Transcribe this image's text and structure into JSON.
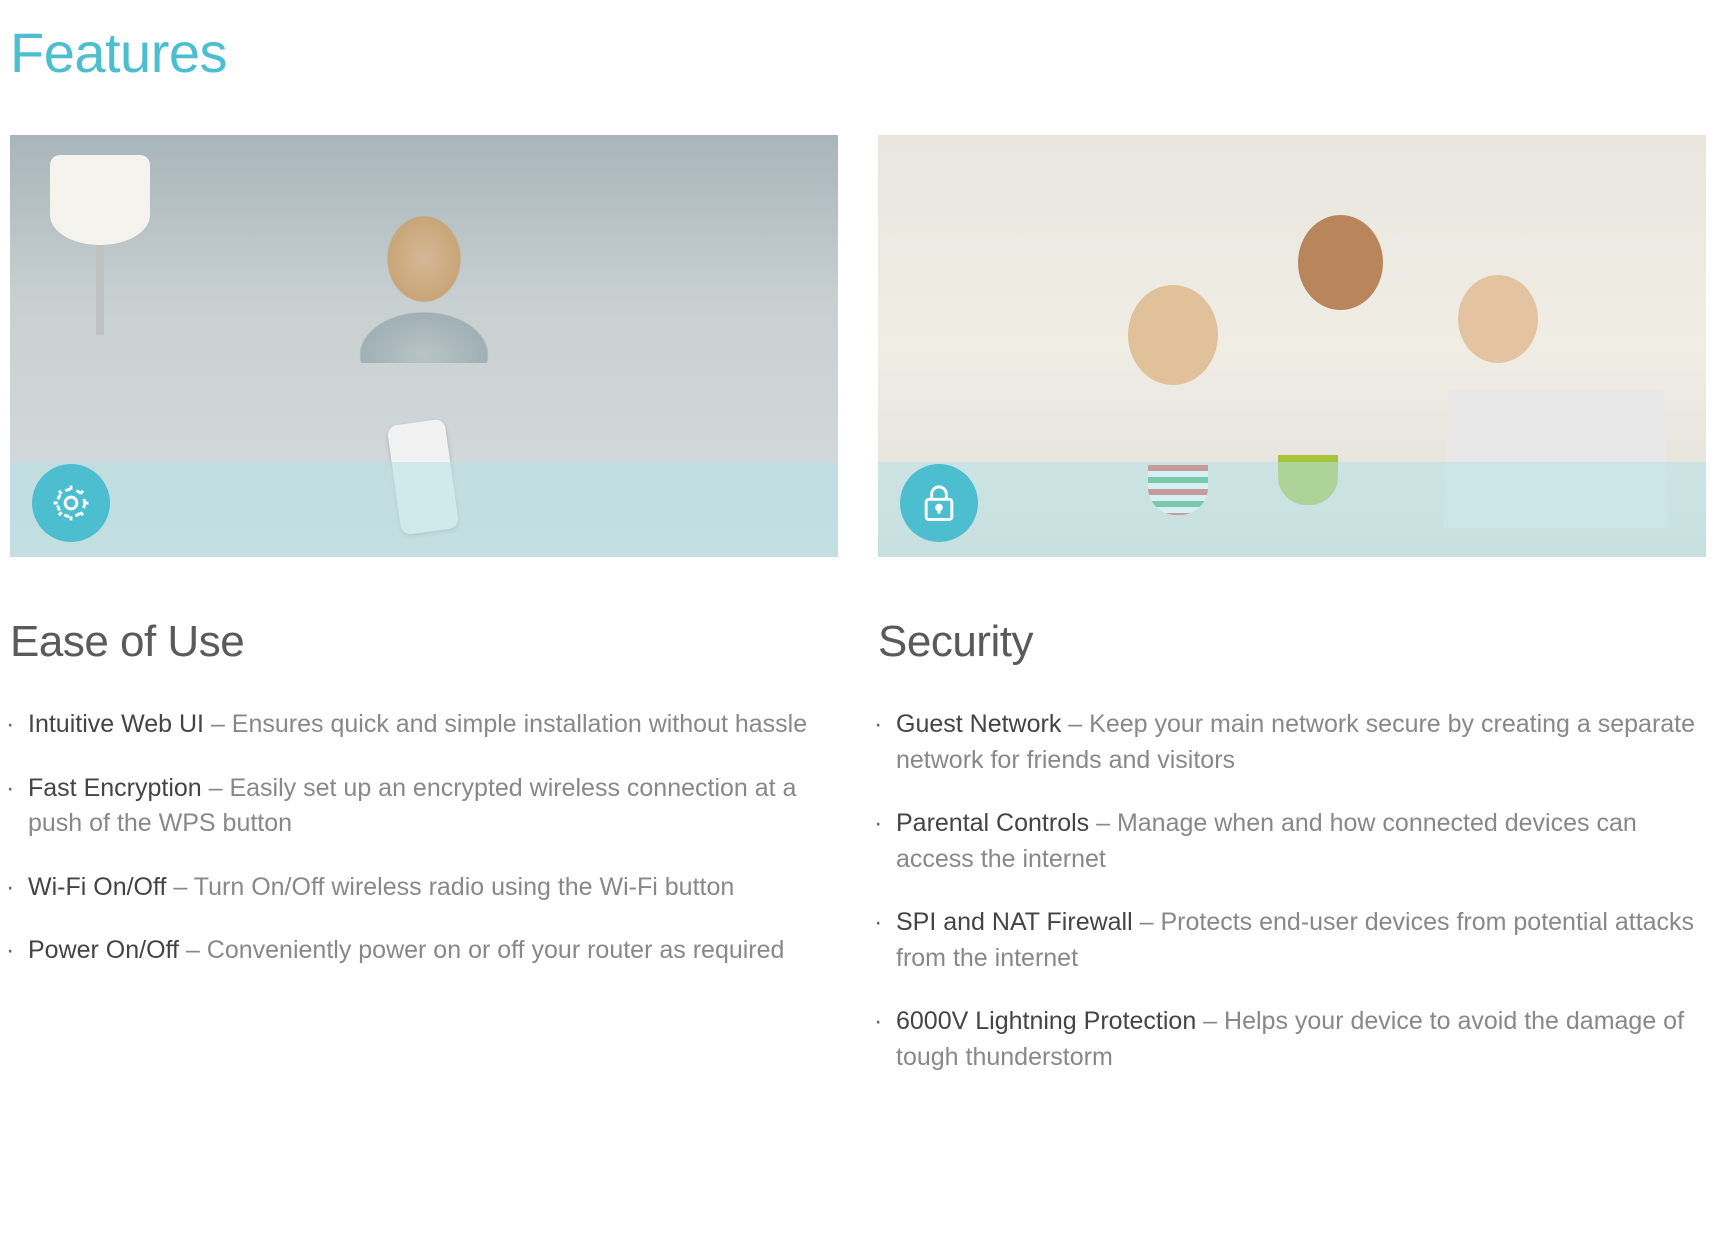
{
  "title": "Features",
  "accent_color": "#4dbecf",
  "columns": [
    {
      "icon": "gear-icon",
      "heading": "Ease of Use",
      "items": [
        {
          "term": "Intuitive Web UI",
          "desc": " – Ensures quick and simple installation without hassle"
        },
        {
          "term": "Fast Encryption",
          "desc": " – Easily set up an encrypted wireless connection at a push of the WPS button"
        },
        {
          "term": "Wi-Fi On/Off",
          "desc": " – Turn On/Off wireless radio using the Wi-Fi button"
        },
        {
          "term": "Power On/Off",
          "desc": " – Conveniently power on or off your router as required"
        }
      ]
    },
    {
      "icon": "lock-icon",
      "heading": "Security",
      "items": [
        {
          "term": "Guest Network",
          "desc": " – Keep your main network secure by creating a separate network for friends and visitors"
        },
        {
          "term": "Parental Controls",
          "desc": " – Manage when and how connected devices can access the internet"
        },
        {
          "term": "SPI and NAT Firewall",
          "desc": " – Protects end-user devices from potential attacks from the internet"
        },
        {
          "term": "6000V Lightning Protection",
          "desc": " – Helps your device to avoid the damage of tough thunderstorm"
        }
      ]
    }
  ]
}
